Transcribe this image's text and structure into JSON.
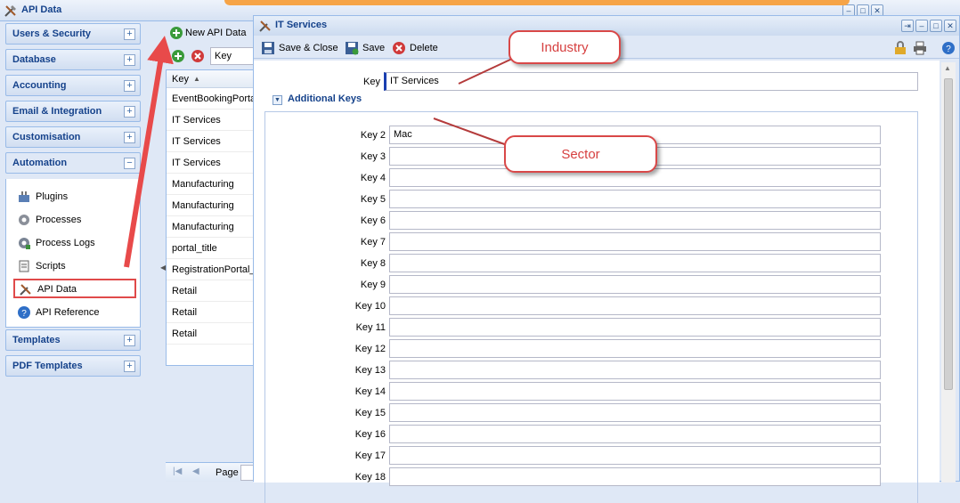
{
  "window": {
    "title": "API Data",
    "min": "–",
    "max": "□",
    "close": "✕"
  },
  "sidebar": {
    "sections": [
      {
        "label": "Users & Security",
        "toggle": "+"
      },
      {
        "label": "Database",
        "toggle": "+"
      },
      {
        "label": "Accounting",
        "toggle": "+"
      },
      {
        "label": "Email & Integration",
        "toggle": "+"
      },
      {
        "label": "Customisation",
        "toggle": "+"
      },
      {
        "label": "Automation",
        "toggle": "−"
      },
      {
        "label": "Templates",
        "toggle": "+"
      },
      {
        "label": "PDF Templates",
        "toggle": "+"
      }
    ],
    "automation_items": [
      {
        "label": "Plugins",
        "icon": "plugin-icon"
      },
      {
        "label": "Processes",
        "icon": "gear-icon"
      },
      {
        "label": "Process Logs",
        "icon": "process-log-icon"
      },
      {
        "label": "Scripts",
        "icon": "script-icon"
      },
      {
        "label": "API Data",
        "icon": "tools-icon"
      },
      {
        "label": "API Reference",
        "icon": "help-icon"
      }
    ]
  },
  "list": {
    "new_button": "New API Data",
    "filter_value": "Key",
    "column_header": "Key",
    "rows": [
      "EventBookingPortal",
      "IT Services",
      "IT Services",
      "IT Services",
      "Manufacturing",
      "Manufacturing",
      "Manufacturing",
      "portal_title",
      "RegistrationPortal_",
      "Retail",
      "Retail",
      "Retail"
    ],
    "pager_label": "Page"
  },
  "dialog": {
    "title": "IT Services",
    "toolbar": {
      "save_close": "Save & Close",
      "save": "Save",
      "delete": "Delete"
    },
    "key_label": "Key",
    "key_value": "IT Services",
    "additional_keys_label": "Additional Keys",
    "keys": [
      {
        "label": "Key 2",
        "value": "Mac"
      },
      {
        "label": "Key 3",
        "value": ""
      },
      {
        "label": "Key 4",
        "value": ""
      },
      {
        "label": "Key 5",
        "value": ""
      },
      {
        "label": "Key 6",
        "value": ""
      },
      {
        "label": "Key 7",
        "value": ""
      },
      {
        "label": "Key 8",
        "value": ""
      },
      {
        "label": "Key 9",
        "value": ""
      },
      {
        "label": "Key 10",
        "value": ""
      },
      {
        "label": "Key 11",
        "value": ""
      },
      {
        "label": "Key 12",
        "value": ""
      },
      {
        "label": "Key 13",
        "value": ""
      },
      {
        "label": "Key 14",
        "value": ""
      },
      {
        "label": "Key 15",
        "value": ""
      },
      {
        "label": "Key 16",
        "value": ""
      },
      {
        "label": "Key 17",
        "value": ""
      },
      {
        "label": "Key 18",
        "value": ""
      }
    ]
  },
  "annotations": {
    "industry": "Industry",
    "sector": "Sector"
  },
  "colors": {
    "accent": "#15428b",
    "annotation": "#d94848",
    "arrow": "#e84a4a",
    "orange": "#f6a447"
  }
}
